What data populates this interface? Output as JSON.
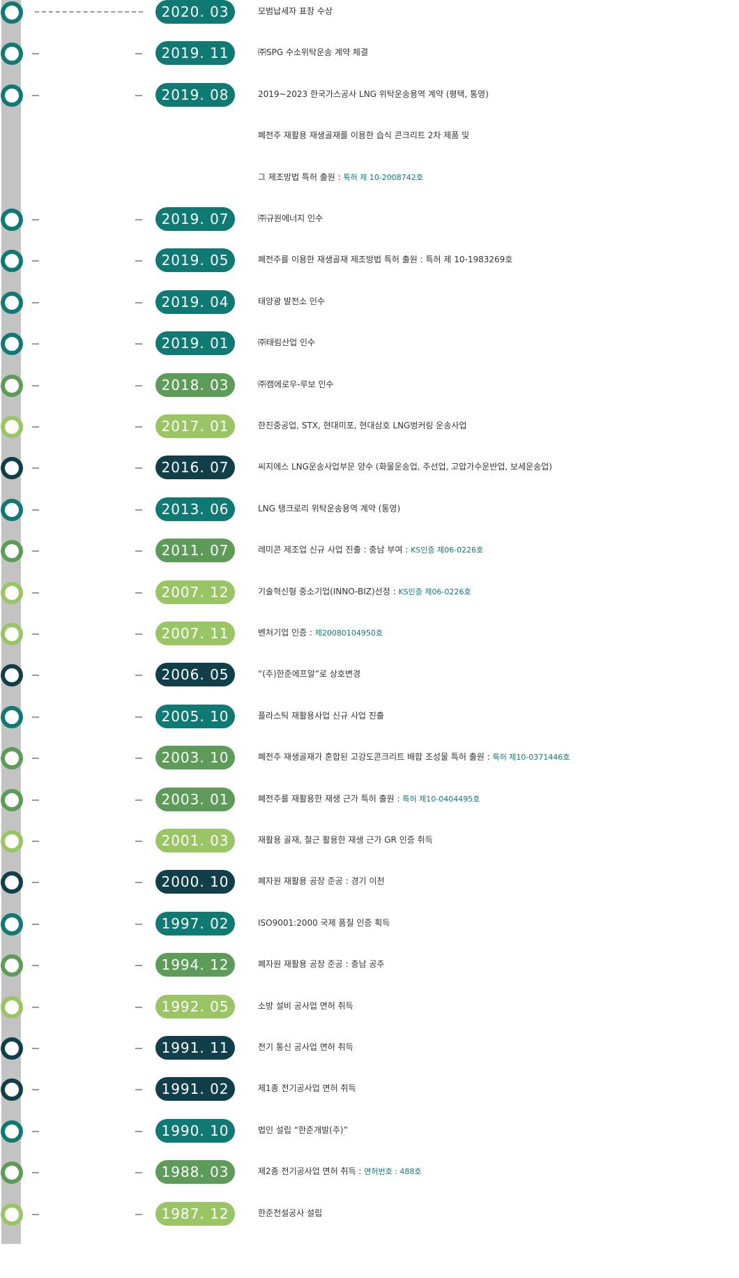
{
  "colors": {
    "teal": "#0f7a74",
    "dark": "#103f4a",
    "green": "#5c9b58",
    "light": "#9ac565",
    "rail": "#c3c3c3",
    "text": "#333333"
  },
  "timeline": {
    "items": [
      {
        "date": "2020. 03",
        "text": "모범납세자 표창 수상",
        "note": "",
        "color": "teal"
      },
      {
        "date": "2019. 11",
        "text": "㈜SPG 수소위탁운송 계약 체결",
        "note": "",
        "color": "teal"
      },
      {
        "date": "2019. 08",
        "text": "2019~2023 한국가스공사 LNG 위탁운송용역 계약 (평택, 통영)",
        "note": "",
        "color": "teal"
      },
      {
        "date": "",
        "text": "폐전주 재활용 재생골재를 이용한 습식 콘크리트 2차 제품 및",
        "note": "",
        "color": "teal"
      },
      {
        "date": "",
        "text": "그 제조방법 특허 출원 : ",
        "note": "특허 제 10-2008742호",
        "color": "teal"
      },
      {
        "date": "2019. 07",
        "text": "㈜규원에너지 인수",
        "note": "",
        "color": "teal"
      },
      {
        "date": "2019. 05",
        "text": "폐전주를 이용한 재생골재 제조방법 특허 출원 : 특허 제 10-1983269호",
        "note": "",
        "color": "teal"
      },
      {
        "date": "2019. 04",
        "text": "태양광 발전소 인수",
        "note": "",
        "color": "teal"
      },
      {
        "date": "2019. 01",
        "text": "㈜태림산업 인수",
        "note": "",
        "color": "teal"
      },
      {
        "date": "2018. 03",
        "text": "㈜캠에로우-루보 인수",
        "note": "",
        "color": "green"
      },
      {
        "date": "2017. 01",
        "text": "한진중공업, STX, 현대미포, 현대삼호 LNG벙커링 운송사업",
        "note": "",
        "color": "light"
      },
      {
        "date": "2016. 07",
        "text": "씨지에스 LNG운송사업부문 양수 (화물운송업, 주선업, 고압가수운반업, 보세운송업)",
        "note": "",
        "color": "dark"
      },
      {
        "date": "2013. 06",
        "text": "LNG 탱크로리 위탁운송용역 계약 (통영)",
        "note": "",
        "color": "teal"
      },
      {
        "date": "2011. 07",
        "text": "레미콘 제조업 신규 사업 진출 : 충남 부여 : ",
        "note": "KS인증 제06-0226호",
        "color": "green"
      },
      {
        "date": "2007. 12",
        "text": "기술혁신형 중소기업(INNO-BIZ)선정 : ",
        "note": "KS인증 제06-0226호",
        "color": "light"
      },
      {
        "date": "2007. 11",
        "text": "벤처기업 인증 : ",
        "note": "제20080104950호",
        "color": "light"
      },
      {
        "date": "2006. 05",
        "text": "“(주)한준에프알”로 상호변경",
        "note": "",
        "color": "dark"
      },
      {
        "date": "2005. 10",
        "text": "플라스틱 재활용사업 신규 사업 진출",
        "note": "",
        "color": "teal"
      },
      {
        "date": "2003. 10",
        "text": "폐전주 재생골재가 혼합된 고강도콘크리트 배합 조성물 특허 출원 : ",
        "note": "특허 제10-0371446호",
        "color": "green"
      },
      {
        "date": "2003. 01",
        "text": "폐전주를 재활용한 재생 근가 특허 출원 : ",
        "note": "특허 제10-0404495호",
        "color": "green"
      },
      {
        "date": "2001. 03",
        "text": "재활용 골재, 철근 활용한 재생 근가 GR 인증 취득",
        "note": "",
        "color": "light"
      },
      {
        "date": "2000. 10",
        "text": "폐자원 재활용 공장 준공 : 경기 이천",
        "note": "",
        "color": "dark"
      },
      {
        "date": "1997. 02",
        "text": "ISO9001:2000 국제 품질 인증 획득",
        "note": "",
        "color": "teal"
      },
      {
        "date": "1994. 12",
        "text": "폐자원 재활용 공장 준공 : 충남 공주",
        "note": "",
        "color": "green"
      },
      {
        "date": "1992. 05",
        "text": "소방 설비 공사업 면허 취득",
        "note": "",
        "color": "light"
      },
      {
        "date": "1991. 11",
        "text": "전기 통신 공사업 면허 취득",
        "note": "",
        "color": "dark"
      },
      {
        "date": "1991. 02",
        "text": "제1종 전기공사업 면허 취득",
        "note": "",
        "color": "dark"
      },
      {
        "date": "1990. 10",
        "text": "법인 설립 “한준개발(주)”",
        "note": "",
        "color": "teal"
      },
      {
        "date": "1988. 03",
        "text": "제2종 전기공사업 면허 취득 : ",
        "note": "면허번호 : 488호",
        "color": "green"
      },
      {
        "date": "1987. 12",
        "text": "한준전설공사 설립",
        "note": "",
        "color": "light"
      }
    ]
  }
}
